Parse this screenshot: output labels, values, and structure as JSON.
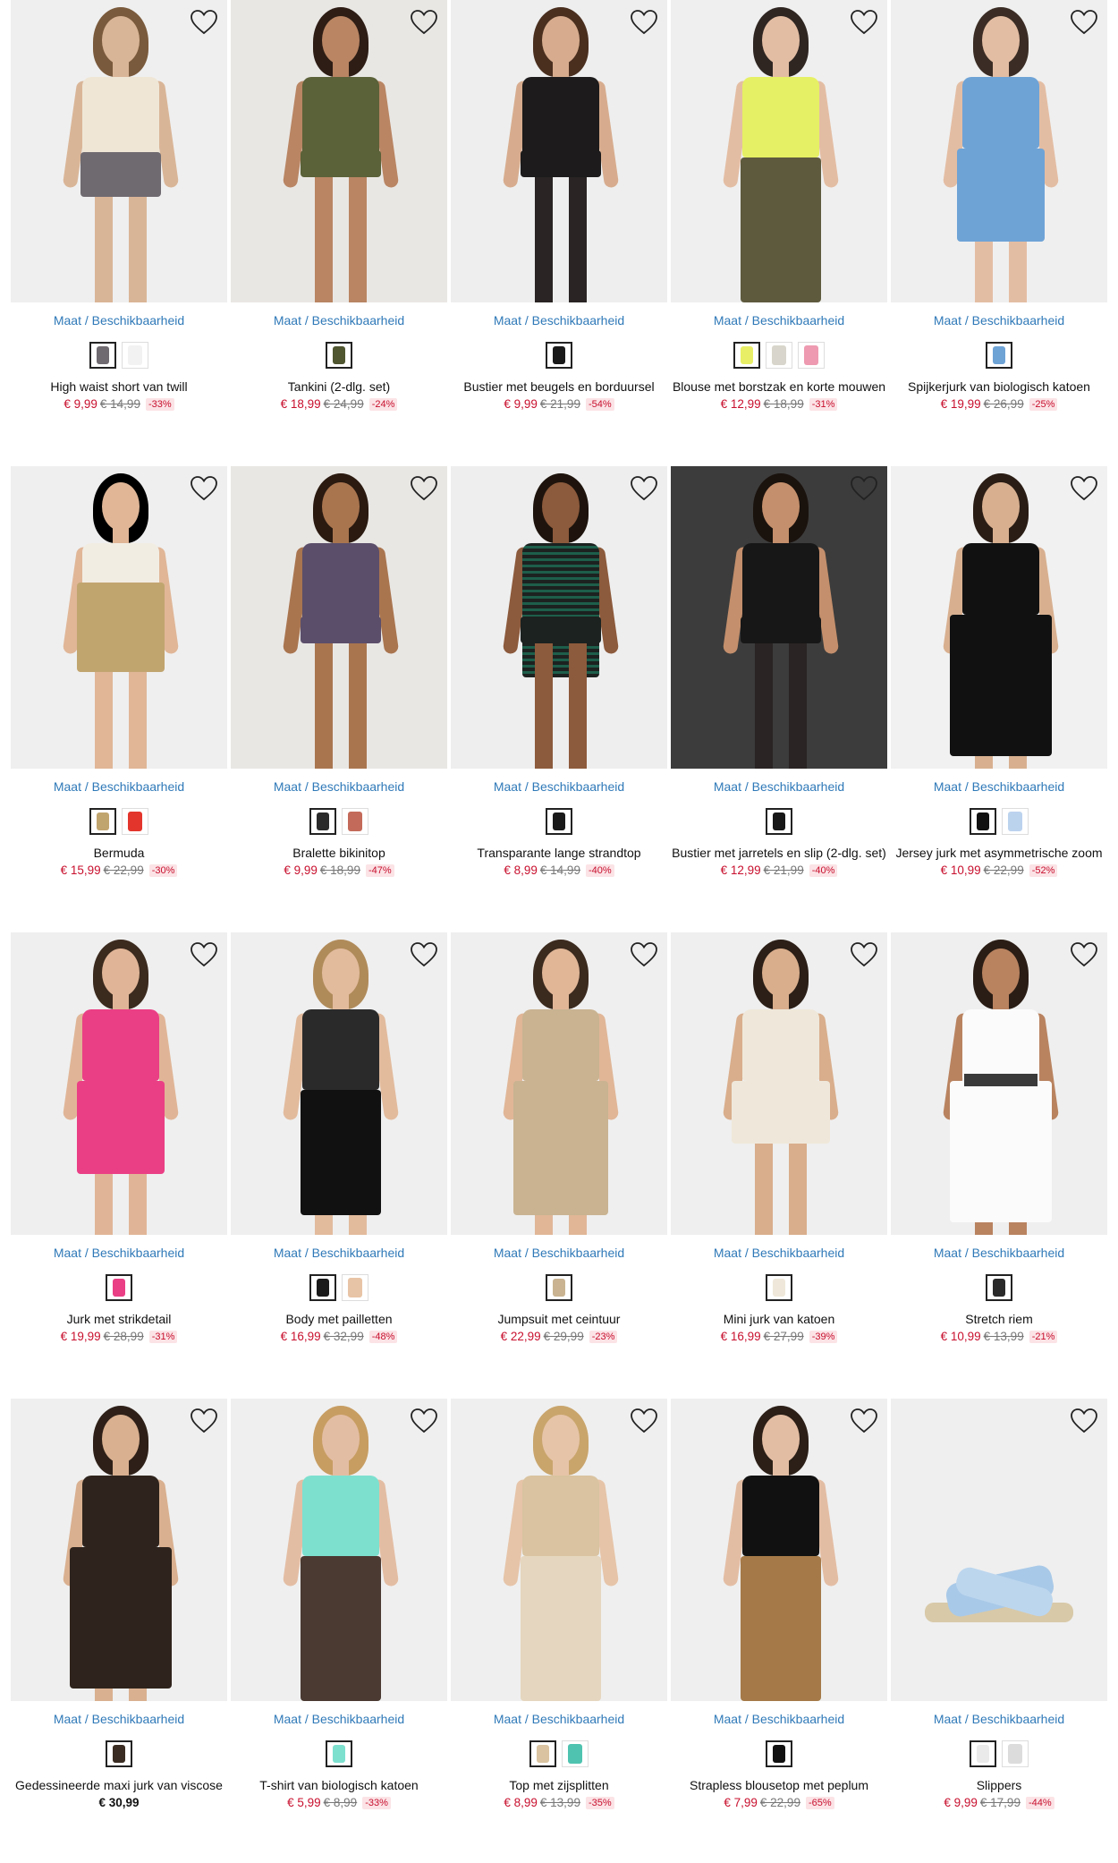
{
  "common": {
    "size_availability": "Maat / Beschikbaarheid"
  },
  "products": [
    {
      "name": "High waist short van twill",
      "price": "€ 9,99",
      "old_price": "€ 14,99",
      "discount": "-33%",
      "bg": "#efefef",
      "skin": "#d9b597",
      "hair": "#7a5a3c",
      "garment": "#6f6a70",
      "top": "#efe6d6",
      "style": "shorts",
      "swatches": [
        "#6f6a70",
        "#f2f2f2"
      ]
    },
    {
      "name": "Tankini (2-dlg. set)",
      "price": "€ 18,99",
      "old_price": "€ 24,99",
      "discount": "-24%",
      "bg": "#e9e7e4",
      "skin": "#b98563",
      "hair": "#2d1d15",
      "garment": "#5b6138",
      "top": "#5b6138",
      "style": "swim",
      "swatches": [
        "#4f5630"
      ]
    },
    {
      "name": "Bustier met beugels en borduursel",
      "price": "€ 9,99",
      "old_price": "€ 21,99",
      "discount": "-54%",
      "bg": "#eeeeee",
      "skin": "#d7ac8e",
      "hair": "#4a2f1f",
      "garment": "#1d1b1b",
      "top": "#1d1b1b",
      "style": "lingerie",
      "swatches": [
        "#1a1a1a"
      ]
    },
    {
      "name": "Blouse met borstzak en korte mouwen",
      "price": "€ 12,99",
      "old_price": "€ 18,99",
      "discount": "-31%",
      "bg": "#efefef",
      "skin": "#e3bda3",
      "hair": "#2f2622",
      "garment": "#5e5a3e",
      "top": "#e6f064",
      "style": "blouse",
      "swatches": [
        "#e8ef66",
        "#d8d6cc",
        "#ee9ab0"
      ]
    },
    {
      "name": "Spijkerjurk van biologisch katoen",
      "price": "€ 19,99",
      "old_price": "€ 26,99",
      "discount": "-25%",
      "bg": "#efefef",
      "skin": "#e3bda3",
      "hair": "#3b2d25",
      "garment": "#6ea3d6",
      "top": "#6ea3d6",
      "style": "dress",
      "swatches": [
        "#6ea3d6"
      ]
    },
    {
      "name": "Bermuda",
      "price": "€ 15,99",
      "old_price": "€ 22,99",
      "discount": "-30%",
      "bg": "#efefef",
      "skin": "#e0b697",
      "hair": "#000000",
      "garment": "#c1a56f",
      "top": "#f2ede3",
      "style": "bermuda",
      "swatches": [
        "#c1a56f",
        "#e3352c"
      ]
    },
    {
      "name": "Bralette bikinitop",
      "price": "€ 9,99",
      "old_price": "€ 18,99",
      "discount": "-47%",
      "bg": "#e9e7e4",
      "skin": "#a9754f",
      "hair": "#2a1a10",
      "garment": "#5b4e6a",
      "top": "#5b4e6a",
      "style": "bikini",
      "swatches": [
        "#2a2a2a",
        "#c46a5a"
      ]
    },
    {
      "name": "Transparante lange strandtop",
      "price": "€ 8,99",
      "old_price": "€ 14,99",
      "discount": "-40%",
      "bg": "#eeeeee",
      "skin": "#8c5a3c",
      "hair": "#1e140d",
      "garment": "#1c2220",
      "top": "#1d5e4a",
      "style": "cover",
      "swatches": [
        "#1a1a1a"
      ]
    },
    {
      "name": "Bustier met jarretels en slip (2-dlg. set)",
      "price": "€ 12,99",
      "old_price": "€ 21,99",
      "discount": "-40%",
      "bg": "#3c3c3c",
      "skin": "#c48f6c",
      "hair": "#1a120d",
      "garment": "#171717",
      "top": "#171717",
      "style": "lingerie",
      "swatches": [
        "#171717"
      ]
    },
    {
      "name": "Jersey jurk met asymmetrische zoom",
      "price": "€ 10,99",
      "old_price": "€ 22,99",
      "discount": "-52%",
      "bg": "#f1f1f1",
      "skin": "#d8b090",
      "hair": "#2a1d15",
      "garment": "#111111",
      "top": "#111111",
      "style": "longdress",
      "swatches": [
        "#111111",
        "#bcd3ee"
      ]
    },
    {
      "name": "Jurk met strikdetail",
      "price": "€ 19,99",
      "old_price": "€ 28,99",
      "discount": "-31%",
      "bg": "#efefef",
      "skin": "#e0b597",
      "hair": "#3b2a1e",
      "garment": "#ea3f85",
      "top": "#ea3f85",
      "style": "dress",
      "swatches": [
        "#ea3f85"
      ]
    },
    {
      "name": "Body met pailletten",
      "price": "€ 16,99",
      "old_price": "€ 32,99",
      "discount": "-48%",
      "bg": "#efefef",
      "skin": "#e2bb9d",
      "hair": "#b08b5a",
      "garment": "#111111",
      "top": "#2a2a2a",
      "style": "body",
      "swatches": [
        "#1a1a1a",
        "#e8c4a6"
      ]
    },
    {
      "name": "Jumpsuit met ceintuur",
      "price": "€ 22,99",
      "old_price": "€ 29,99",
      "discount": "-23%",
      "bg": "#efefef",
      "skin": "#e0b697",
      "hair": "#3b2a1e",
      "garment": "#c9b391",
      "top": "#c9b391",
      "style": "jumpsuit",
      "swatches": [
        "#c9b391"
      ]
    },
    {
      "name": "Mini jurk van katoen",
      "price": "€ 16,99",
      "old_price": "€ 27,99",
      "discount": "-39%",
      "bg": "#efefef",
      "skin": "#d9ae8c",
      "hair": "#2b1f17",
      "garment": "#efe8da",
      "top": "#efe8da",
      "style": "minidress",
      "swatches": [
        "#efe8da"
      ]
    },
    {
      "name": "Stretch riem",
      "price": "€ 10,99",
      "old_price": "€ 13,99",
      "discount": "-21%",
      "bg": "#efefef",
      "skin": "#b98360",
      "hair": "#2a1d15",
      "garment": "#fbfbfb",
      "top": "#fbfbfb",
      "style": "belt",
      "swatches": [
        "#2a2a2a"
      ]
    },
    {
      "name": "Gedessineerde maxi jurk van viscose",
      "price": "€ 30,99",
      "old_price": "",
      "discount": "",
      "bg": "#efefef",
      "skin": "#d9b090",
      "hair": "#2e2018",
      "garment": "#2f241d",
      "top": "#2f241d",
      "style": "longdress",
      "swatches": [
        "#3a2c22"
      ]
    },
    {
      "name": "T-shirt van biologisch katoen",
      "price": "€ 5,99",
      "old_price": "€ 8,99",
      "discount": "-33%",
      "bg": "#efefef",
      "skin": "#e3bda3",
      "hair": "#c79d62",
      "garment": "#4a3a32",
      "top": "#7de0cf",
      "style": "tshirt",
      "swatches": [
        "#7de0cf"
      ]
    },
    {
      "name": "Top met zijsplitten",
      "price": "€ 8,99",
      "old_price": "€ 13,99",
      "discount": "-35%",
      "bg": "#efefef",
      "skin": "#e6c4a8",
      "hair": "#c9a56c",
      "garment": "#e5d6bf",
      "top": "#d9c3a0",
      "style": "tshirt",
      "swatches": [
        "#d9c3a0",
        "#4fc3b0"
      ]
    },
    {
      "name": "Strapless blousetop met peplum",
      "price": "€ 7,99",
      "old_price": "€ 22,99",
      "discount": "-65%",
      "bg": "#efefef",
      "skin": "#e3bda3",
      "hair": "#2b1f17",
      "garment": "#a57a48",
      "top": "#111111",
      "style": "peplum",
      "swatches": [
        "#111111"
      ]
    },
    {
      "name": "Slippers",
      "price": "€ 9,99",
      "old_price": "€ 17,99",
      "discount": "-44%",
      "bg": "#efefef",
      "skin": "",
      "hair": "",
      "garment": "#a9c9e8",
      "top": "#d8c9a8",
      "style": "slipper",
      "swatches": [
        "#eaeaea",
        "#dcdcdc"
      ]
    }
  ]
}
